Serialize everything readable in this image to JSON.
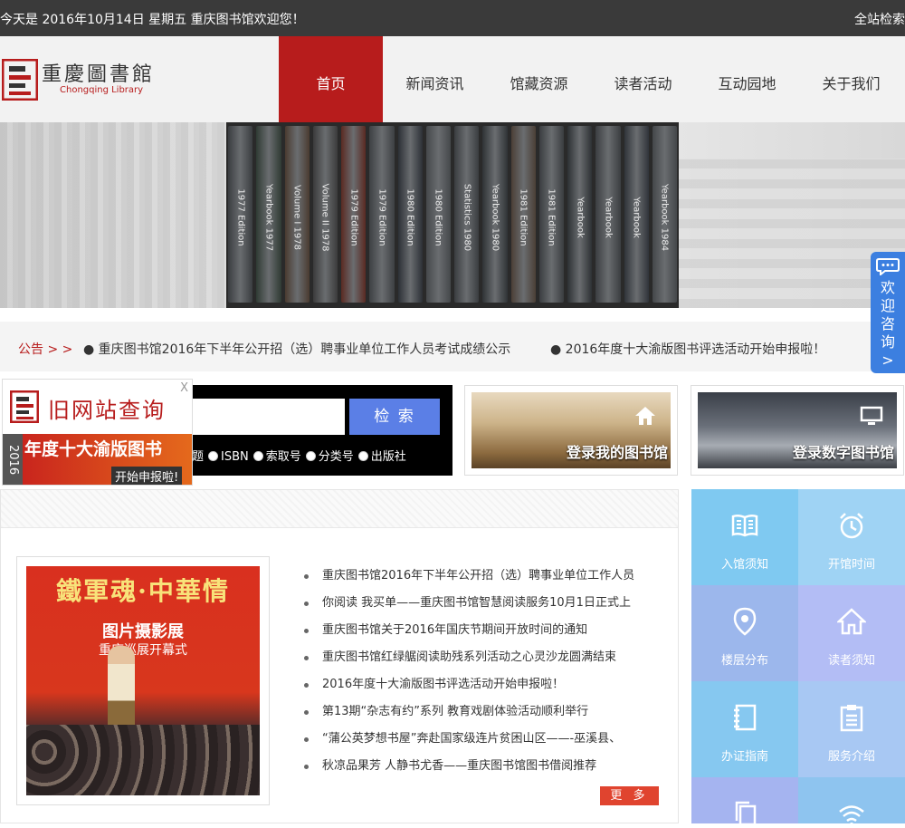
{
  "topbar": {
    "date_text": "今天是 2016年10月14日 星期五 重庆图书馆欢迎您！",
    "site_search": "全站检索"
  },
  "logo": {
    "cn": "重慶圖書館",
    "en": "Chongqing Library"
  },
  "nav": [
    {
      "label": "首页",
      "active": true
    },
    {
      "label": "新闻资讯",
      "active": false
    },
    {
      "label": "馆藏资源",
      "active": false
    },
    {
      "label": "读者活动",
      "active": false
    },
    {
      "label": "互动园地",
      "active": false
    },
    {
      "label": "关于我们",
      "active": false
    }
  ],
  "banner": {
    "books": [
      "1977 Edition",
      "Yearbook 1977",
      "Volume I 1978",
      "Volume II 1978",
      "1979 Edition",
      "1979 Edition",
      "1980 Edition",
      "1980 Edition",
      "Statistics 1980",
      "Yearbook 1980",
      "1981 Edition",
      "1981 Edition",
      "Yearbook",
      "Yearbook",
      "Yearbook",
      "Yearbook 1984"
    ]
  },
  "notice": {
    "label": "公告 > >",
    "items": [
      "● 重庆图书馆2016年下半年公开招（选）聘事业单位工作人员考试成绩公示",
      "● 2016年度十大渝版图书评选活动开始申报啦！"
    ]
  },
  "chat": {
    "text": [
      "欢",
      "迎",
      "咨",
      "询",
      ">"
    ]
  },
  "search": {
    "button": "检 索",
    "options": [
      "题",
      "ISBN",
      "索取号",
      "分类号",
      "出版社"
    ]
  },
  "oldsite": {
    "close": "X",
    "title": "旧网站查询",
    "year": "2016",
    "promo": "年度十大渝版图书",
    "promo_tag": "评选",
    "promo_sub": "开始申报啦!"
  },
  "cards": [
    {
      "label": "登录我的图书馆",
      "icon": "home-icon"
    },
    {
      "label": "登录数字图书馆",
      "icon": "monitor-icon"
    }
  ],
  "news": {
    "photo": {
      "title": "鐵軍魂·中華情",
      "sub": "图片摄影展",
      "sub2": "重庆巡展开幕式"
    },
    "items": [
      "重庆图书馆2016年下半年公开招（选）聘事业单位工作人员",
      "你阅读 我买单——重庆图书馆智慧阅读服务10月1日正式上",
      "重庆图书馆关于2016年国庆节期间开放时间的通知",
      "重庆图书馆红绿艍阅读助残系列活动之心灵沙龙圆满结束",
      "2016年度十大渝版图书评选活动开始申报啦！",
      "第13期“杂志有约”系列 教育戏剧体验活动顺利举行",
      "“蒲公英梦想书屋”奔赴国家级连片贫困山区——-巫溪县、",
      "秋凉品果芳 人静书尤香——重庆图书馆图书借阅推荐"
    ],
    "more": "更 多"
  },
  "tiles": [
    {
      "label": "入馆须知",
      "icon": "book-icon",
      "color": "#7fc9f1"
    },
    {
      "label": "开馆时间",
      "icon": "alarm-clock-icon",
      "color": "#9fd3f4"
    },
    {
      "label": "楼层分布",
      "icon": "location-pin-icon",
      "color": "#9cb7ec"
    },
    {
      "label": "读者须知",
      "icon": "house-icon",
      "color": "#b3bdf5"
    },
    {
      "label": "办证指南",
      "icon": "notebook-icon",
      "color": "#86c8f0"
    },
    {
      "label": "服务介绍",
      "icon": "document-list-icon",
      "color": "#a8c8f3"
    },
    {
      "label": "",
      "icon": "copy-icon",
      "color": "#a5b4f0"
    },
    {
      "label": "",
      "icon": "wifi-icon",
      "color": "#8ec4ef"
    }
  ],
  "colors": {
    "accent": "#b71c1c",
    "topbar": "#3a3a3a",
    "search_button": "#5b7fe6",
    "more_button": "#e0442f",
    "chat": "#3c7fe0"
  }
}
